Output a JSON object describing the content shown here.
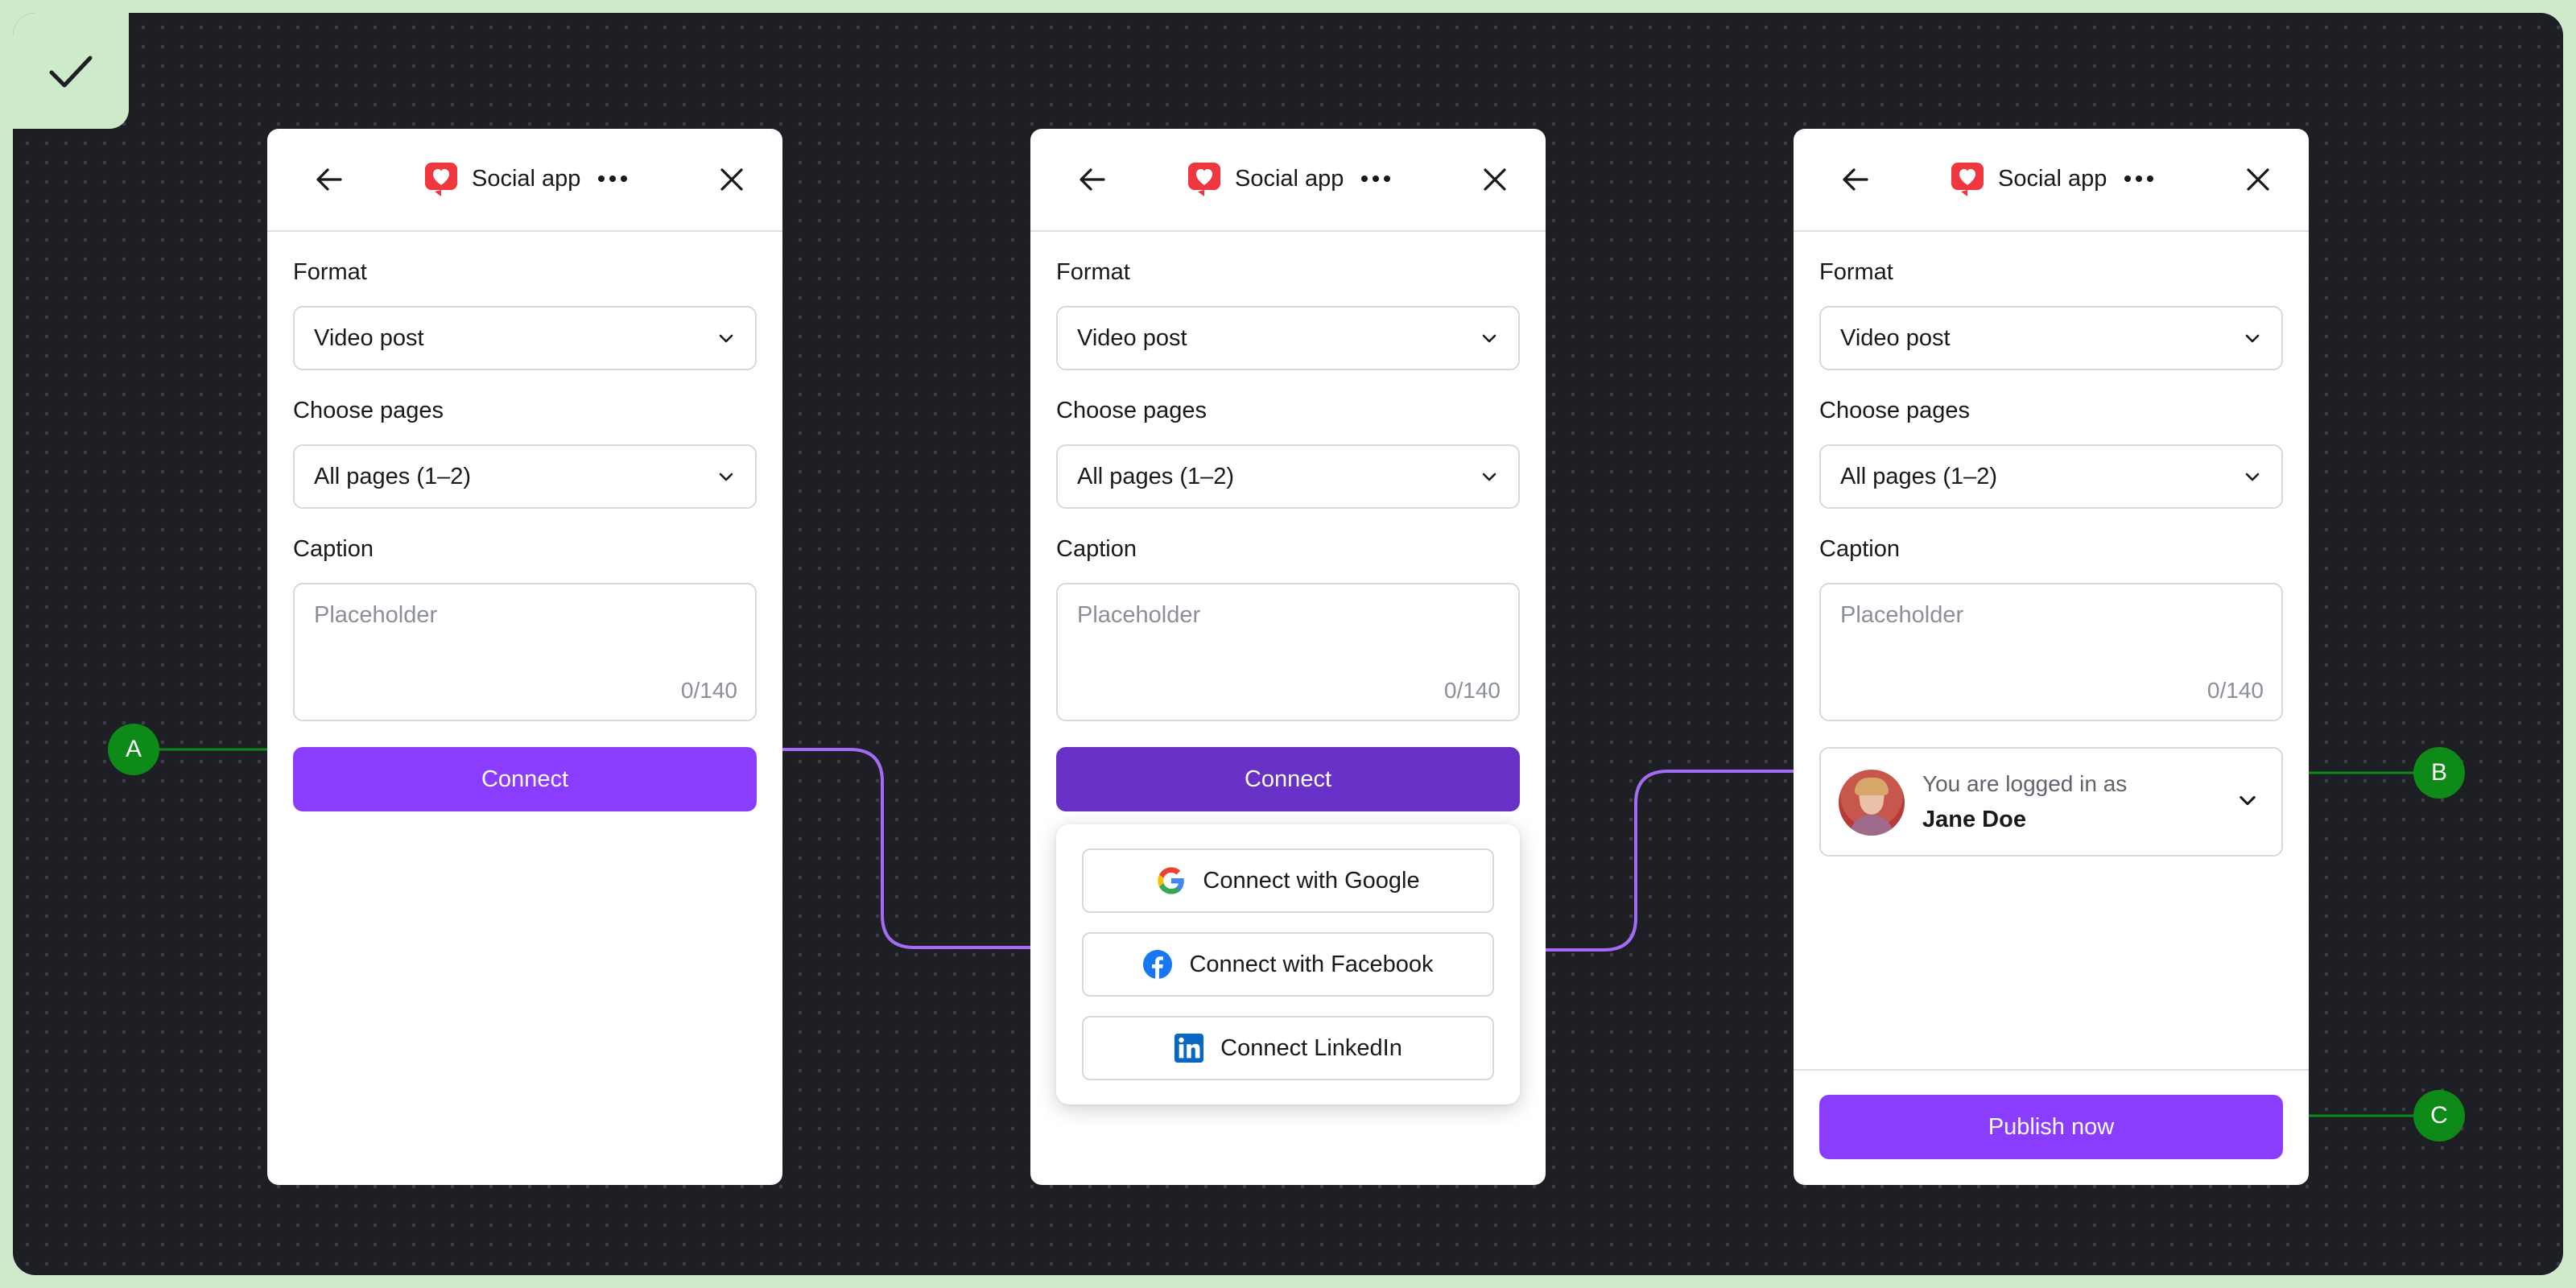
{
  "colors": {
    "accent": "#8b3dff",
    "accent_pressed": "#6831c8",
    "connector": "#a46cf5",
    "marker": "#0d8a17",
    "canvas": "#1d1f24",
    "frame": "#cdeacb"
  },
  "badge_icon": "checkmark-icon",
  "app": {
    "title": "Social app",
    "icon": "heart-icon"
  },
  "form": {
    "format_label": "Format",
    "format_value": "Video post",
    "pages_label": "Choose pages",
    "pages_value": "All pages (1–2)",
    "caption_label": "Caption",
    "caption_placeholder": "Placeholder",
    "caption_count": "0/140"
  },
  "connect_button": "Connect",
  "connect_menu": [
    {
      "label": "Connect with Google",
      "icon": "google-icon"
    },
    {
      "label": "Connect with Facebook",
      "icon": "facebook-icon"
    },
    {
      "label": "Connect LinkedIn",
      "icon": "linkedin-icon"
    }
  ],
  "account": {
    "status": "You are logged in as",
    "name": "Jane Doe"
  },
  "publish_button": "Publish now",
  "markers": {
    "a": "A",
    "b": "B",
    "c": "C"
  }
}
